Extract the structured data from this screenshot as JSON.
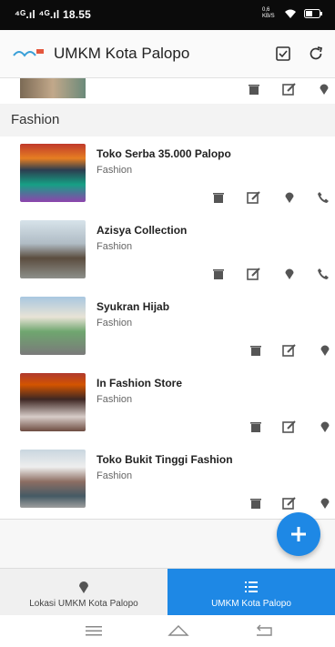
{
  "status": {
    "left": "⁴ᴳ.ıl ⁴ᴳ.ıl 18.55",
    "right_text": "0,6 KB/S"
  },
  "app": {
    "title": "UMKM Kota Palopo"
  },
  "section": {
    "title": "Fashion"
  },
  "stores": [
    {
      "name": "Toko Serba 35.000 Palopo",
      "category": "Fashion",
      "has_phone": true
    },
    {
      "name": "Azisya Collection",
      "category": "Fashion",
      "has_phone": true
    },
    {
      "name": "Syukran Hijab",
      "category": "Fashion",
      "has_phone": false
    },
    {
      "name": "In Fashion Store",
      "category": "Fashion",
      "has_phone": false
    },
    {
      "name": "Toko Bukit Tinggi Fashion",
      "category": "Fashion",
      "has_phone": false
    }
  ],
  "nav": {
    "map_label": "Lokasi UMKM Kota Palopo",
    "list_label": "UMKM Kota Palopo"
  },
  "colors": {
    "accent": "#1e88e5",
    "icon": "#555555"
  }
}
